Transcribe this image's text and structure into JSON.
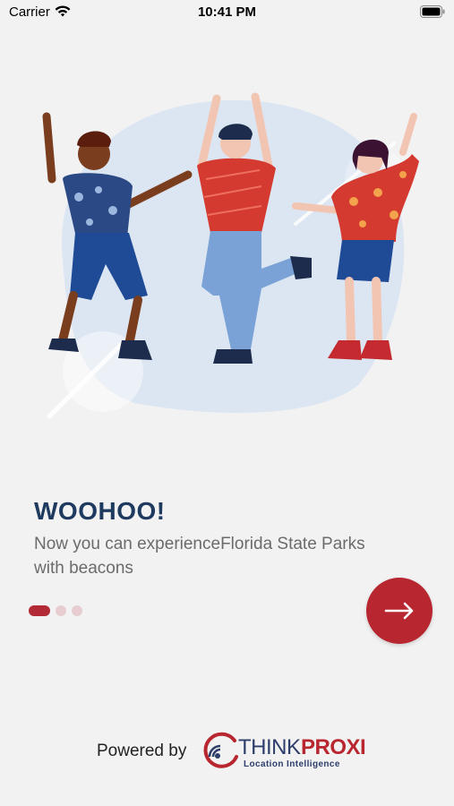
{
  "status_bar": {
    "carrier": "Carrier",
    "time": "10:41 PM",
    "wifi_icon": "wifi-icon",
    "battery_icon": "battery-icon"
  },
  "onboarding": {
    "headline": "WOOHOO!",
    "subtitle": "Now you can experienceFlorida State Parks with beacons",
    "page_indicator": {
      "total": 3,
      "current": 1
    },
    "next_icon": "arrow-right-icon"
  },
  "footer": {
    "powered_by": "Powered by",
    "logo_think": "THINK",
    "logo_proxi": "PROXI",
    "logo_tagline": "Location Intelligence"
  },
  "colors": {
    "background": "#f2f2f2",
    "accent": "#b8272f",
    "headline": "#1e3a5f",
    "blob": "#dce6f2"
  }
}
